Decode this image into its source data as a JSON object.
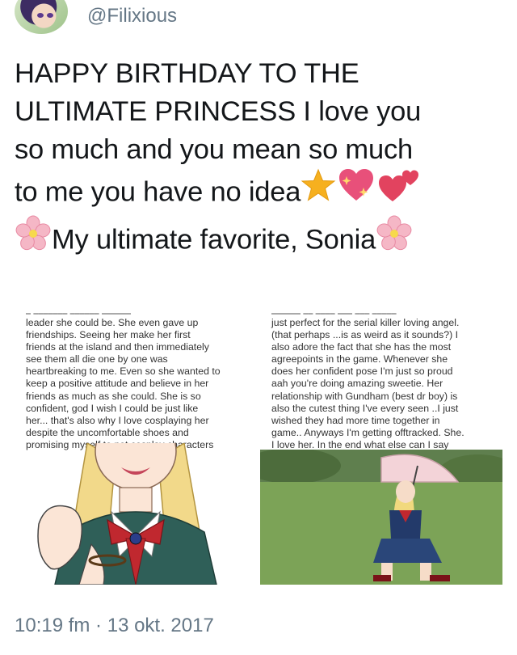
{
  "user": {
    "handle": "@Filixious"
  },
  "tweet": {
    "lines": [
      "HAPPY BIRTHDAY TO THE",
      "ULTIMATE PRINCESS I love you",
      "so much and you mean so much",
      "to me you have no idea",
      "My ultimate favorite, Sonia"
    ]
  },
  "icons": {
    "star": "star-emoji",
    "sparkling_heart": "sparkling-heart-emoji",
    "two_hearts": "two-hearts-emoji",
    "blossom": "cherry-blossom-emoji"
  },
  "media": {
    "left_snippet": "leader she could be. She even gave up\nfriendships. Seeing her make her first\nfriends at the island and then immediately\nsee them all die one by one was\nheartbreaking to me. Even so she wanted to\nkeep a positive attitude and believe in her\nfriends as much as she could. She is so\nconfident, god I wish I could be just like\nher... that's also why I love cosplaying her\ndespite the uncomfortable shoes and\npromising myself to not cosplay characters",
    "right_snippet": "just perfect for the serial killer loving angel.\n(that perhaps ...is as weird as it sounds?) I\nalso adore the fact that she has the most\nagreepoints in the game. Whenever she\ndoes her confident pose I'm just so proud\naah you're doing amazing sweetie. Her\nrelationship with Gundham (best dr boy) is\nalso the cutest thing I've every seen ..I just\nwished they had more time together in\ngame.. Anyways I'm getting offtracked. She.\nI love her. In the end what else can I say"
  },
  "footer": {
    "timestamp": "10:19 fm · 13 okt. 2017"
  },
  "colors": {
    "text": "#14171a",
    "secondary": "#657786",
    "accent_red": "#c0282f"
  }
}
